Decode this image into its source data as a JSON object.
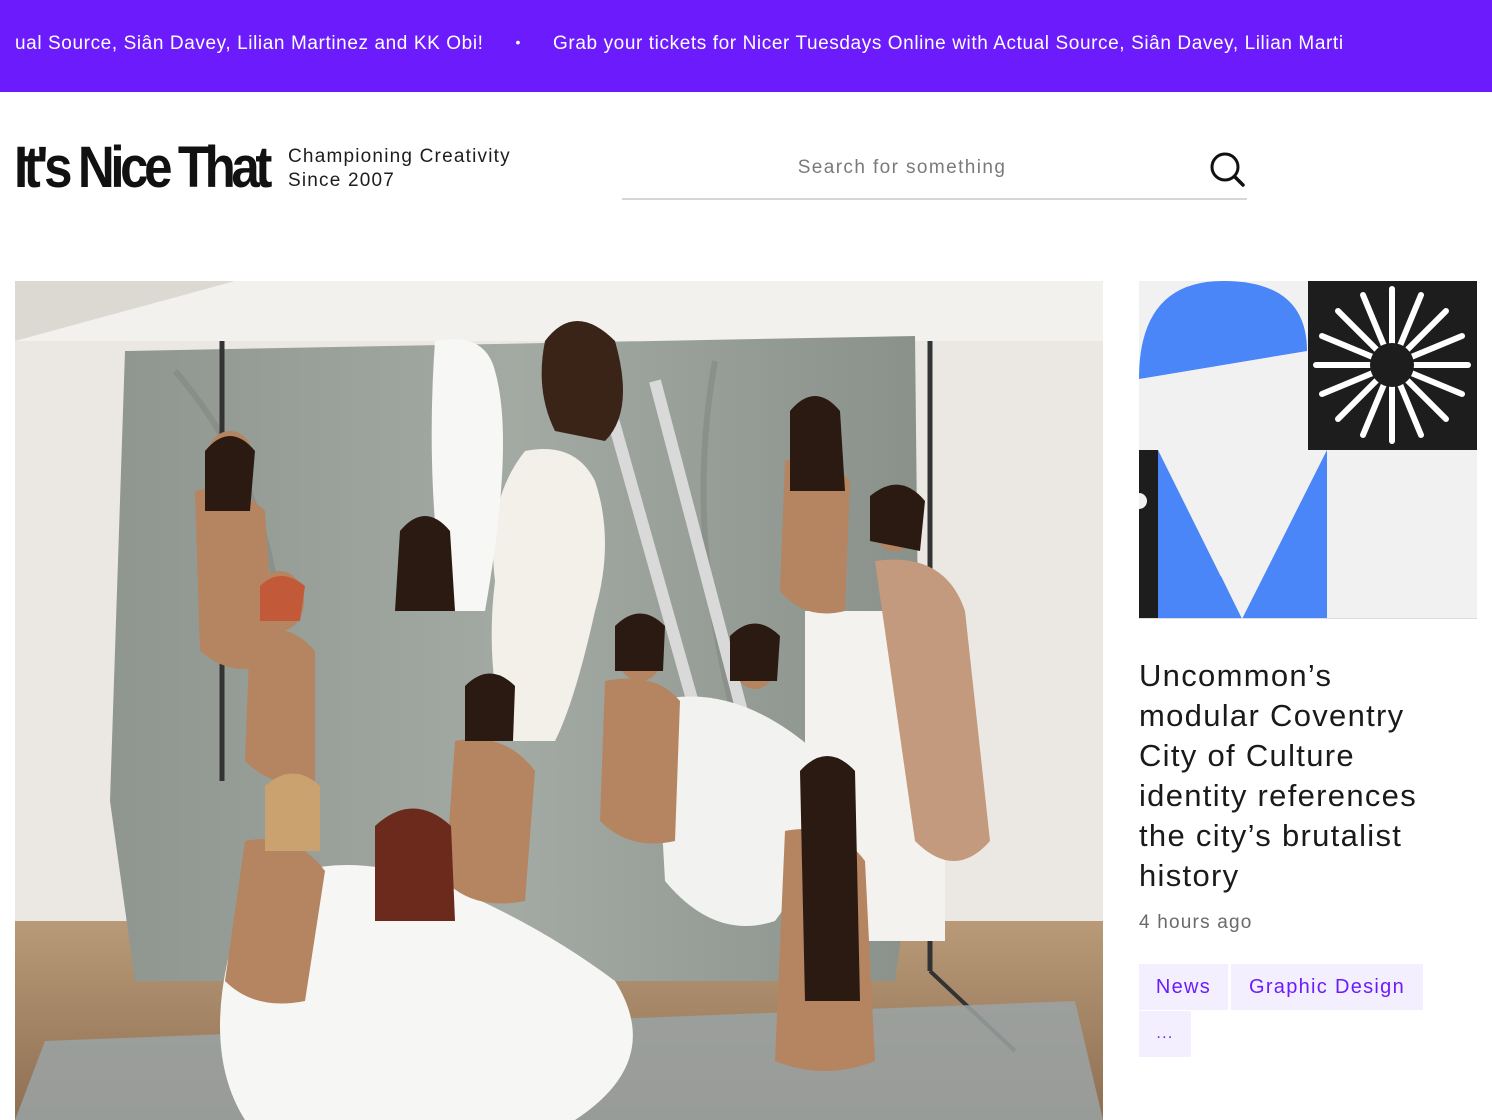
{
  "ticker": {
    "message_partial": "ual Source, Siân Davey, Lilian Martinez and KK Obi!",
    "separator": "•",
    "message": "Grab your tickets for Nicer Tuesdays Online with Actual Source, Siân Davey, Lilian Marti"
  },
  "header": {
    "logo": "It's Nice That",
    "tagline_line1": "Championing Creativity",
    "tagline_line2": "Since 2007",
    "search_placeholder": "Search for something",
    "search_icon": "search-icon"
  },
  "featured": {
    "image_alt": "Group photograph of women posing in a studio"
  },
  "sidebar_article": {
    "title": "Uncommon’s modular Coventry City of Culture identity references the city’s brutalist history",
    "time": "4 hours ago",
    "tags": [
      "News",
      "Graphic Design",
      "..."
    ]
  },
  "colors": {
    "accent": "#6c1cfc",
    "tag_bg": "#f3efff",
    "blue": "#4a86f7"
  }
}
